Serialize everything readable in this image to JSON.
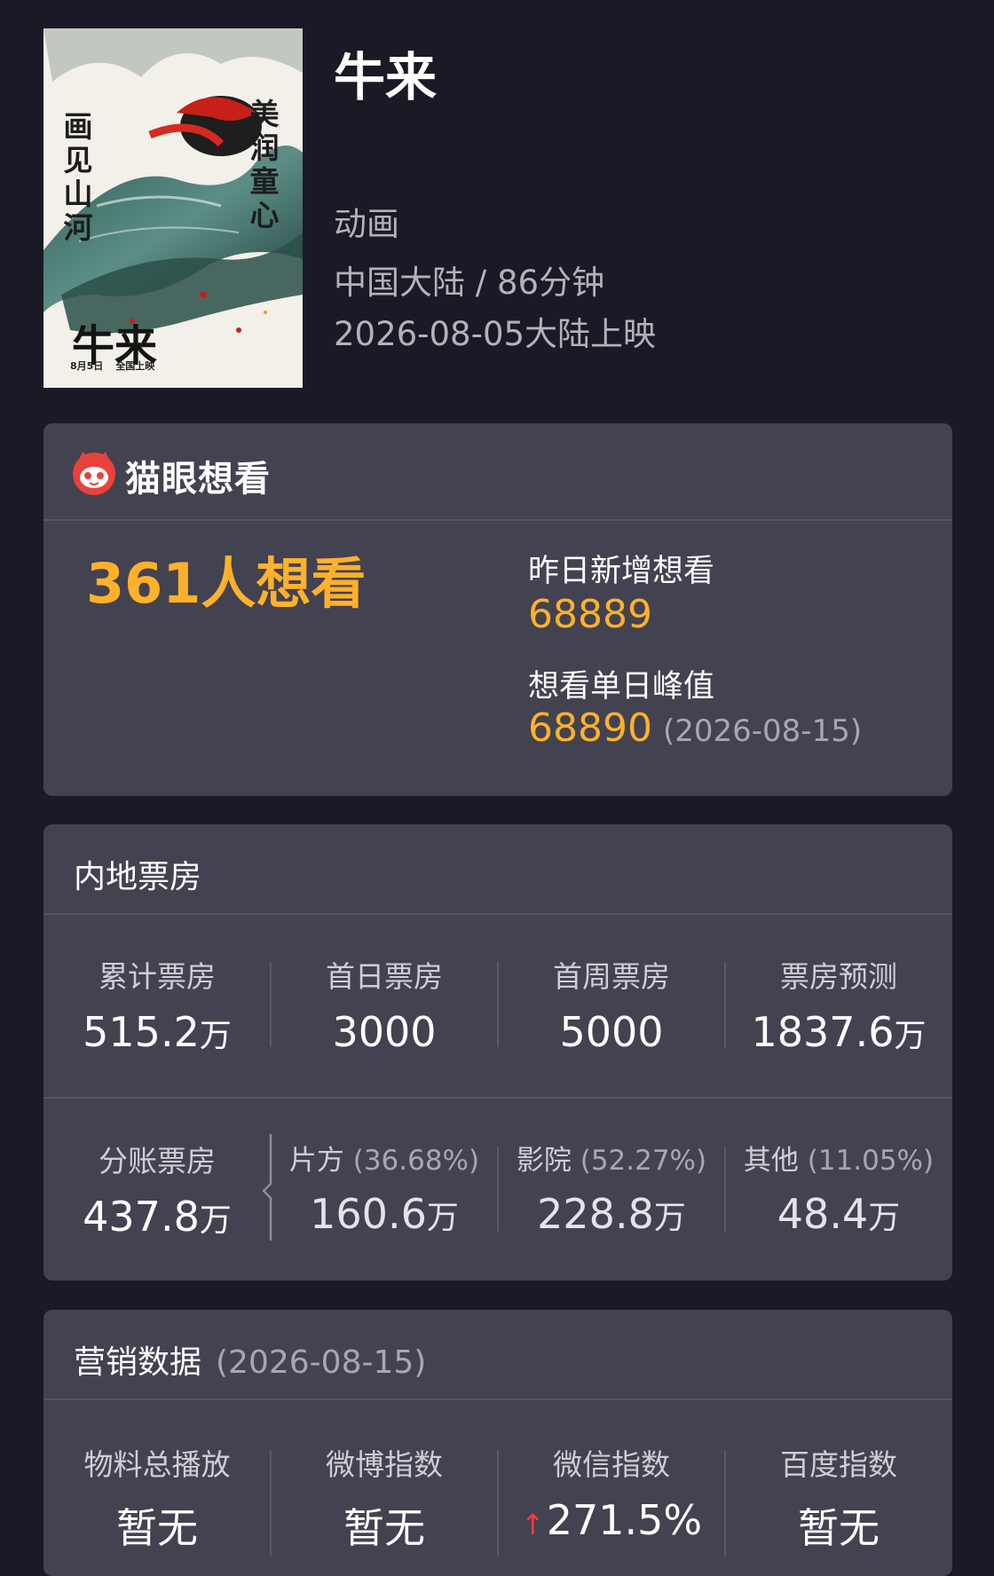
{
  "movie": {
    "title": "牛来",
    "genre": "动画",
    "region_duration": "中国大陆 / 86分钟",
    "release": "2026-08-05大陆上映"
  },
  "poster": {
    "vertical_left": "画见山河",
    "vertical_right": "美润童心",
    "big_title": "牛来",
    "date_line": "8月5日",
    "date_line2": "全国上映"
  },
  "maoyan": {
    "brand": "猫眼想看",
    "want_total": "361人想看",
    "yesterday_label": "昨日新增想看",
    "yesterday_value": "68889",
    "peak_label": "想看单日峰值",
    "peak_value": "68890",
    "peak_date": "(2026-08-15)"
  },
  "boxoffice": {
    "title": "内地票房",
    "top": [
      {
        "label": "累计票房",
        "value": "515.2",
        "unit": "万"
      },
      {
        "label": "首日票房",
        "value": "3000",
        "unit": ""
      },
      {
        "label": "首周票房",
        "value": "5000",
        "unit": ""
      },
      {
        "label": "票房预测",
        "value": "1837.6",
        "unit": "万"
      }
    ],
    "split_total": {
      "label": "分账票房",
      "value": "437.8",
      "unit": "万"
    },
    "split": [
      {
        "label": "片方",
        "pct": "(36.68%)",
        "value": "160.6",
        "unit": "万"
      },
      {
        "label": "影院",
        "pct": "(52.27%)",
        "value": "228.8",
        "unit": "万"
      },
      {
        "label": "其他",
        "pct": "(11.05%)",
        "value": "48.4",
        "unit": "万"
      }
    ]
  },
  "marketing": {
    "title": "营销数据",
    "date": "(2026-08-15)",
    "items": [
      {
        "label": "物料总播放",
        "value": "暂无"
      },
      {
        "label": "微博指数",
        "value": "暂无"
      },
      {
        "label": "微信指数",
        "value": "271.5%",
        "arrow": "↑"
      },
      {
        "label": "百度指数",
        "value": "暂无"
      }
    ]
  },
  "colors": {
    "background": "#1a1926",
    "card": "#434250",
    "accent_orange": "#ffb12b",
    "up_red": "#ff3b3b"
  }
}
